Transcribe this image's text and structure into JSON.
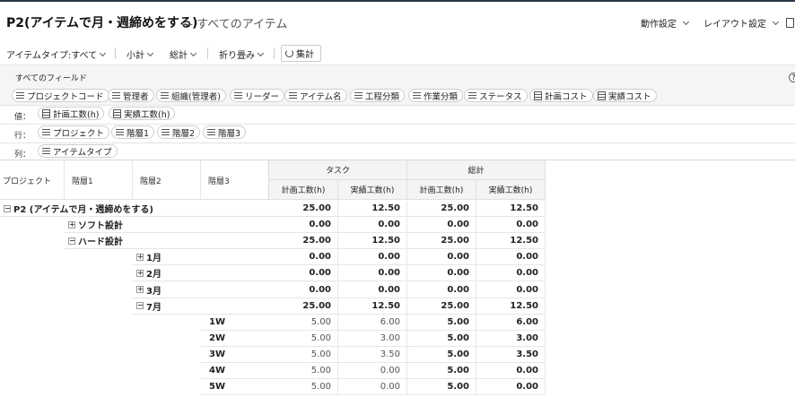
{
  "header": {
    "title": "P2(アイテムで月・週締めをする)",
    "subtitle": "— すべてのアイテム",
    "menu_action": "動作設定",
    "menu_layout": "レイアウト設定"
  },
  "toolbar": {
    "item_type": "アイテムタイプ:すべて",
    "subtotal": "小計",
    "total": "総計",
    "fold": "折り畳み",
    "aggregate": "集計"
  },
  "fields": {
    "label": "すべてのフィールド",
    "chips": [
      "プロジェクトコード",
      "管理者",
      "組織(管理者)",
      "リーダー",
      "アイテム名",
      "工程分類",
      "作業分類",
      "ステータス",
      "計画コスト",
      "実績コスト"
    ]
  },
  "zones": {
    "values_label": "値：",
    "values": [
      "計画工数(h)",
      "実績工数(h)"
    ],
    "rows_label": "行：",
    "rows": [
      "プロジェクト",
      "階層1",
      "階層2",
      "階層3"
    ],
    "cols_label": "列：",
    "cols": [
      "アイテムタイプ"
    ]
  },
  "grid": {
    "row_headers": [
      "プロジェクト",
      "階層1",
      "階層2",
      "階層3"
    ],
    "groups": [
      "タスク",
      "総計"
    ],
    "measures": [
      "計画工数(h)",
      "実績工数(h)",
      "計画工数(h)",
      "実績工数(h)"
    ],
    "rows": [
      {
        "label": "P2 (アイテムで月・週締めをする)",
        "toggle": "−",
        "values": [
          "25.00",
          "12.50",
          "25.00",
          "12.50"
        ],
        "bold": true
      },
      {
        "label": "ソフト設計",
        "toggle": "+",
        "values": [
          "0.00",
          "0.00",
          "0.00",
          "0.00"
        ],
        "bold": true
      },
      {
        "label": "ハード設計",
        "toggle": "−",
        "values": [
          "25.00",
          "12.50",
          "25.00",
          "12.50"
        ],
        "bold": true
      },
      {
        "label": "1月",
        "toggle": "+",
        "values": [
          "0.00",
          "0.00",
          "0.00",
          "0.00"
        ],
        "bold": true
      },
      {
        "label": "2月",
        "toggle": "+",
        "values": [
          "0.00",
          "0.00",
          "0.00",
          "0.00"
        ],
        "bold": true
      },
      {
        "label": "3月",
        "toggle": "+",
        "values": [
          "0.00",
          "0.00",
          "0.00",
          "0.00"
        ],
        "bold": true
      },
      {
        "label": "7月",
        "toggle": "−",
        "values": [
          "25.00",
          "12.50",
          "25.00",
          "12.50"
        ],
        "bold": true
      },
      {
        "label": "1W",
        "toggle": "",
        "values": [
          "5.00",
          "6.00",
          "5.00",
          "6.00"
        ],
        "bold": false
      },
      {
        "label": "2W",
        "toggle": "",
        "values": [
          "5.00",
          "3.00",
          "5.00",
          "3.00"
        ],
        "bold": false
      },
      {
        "label": "3W",
        "toggle": "",
        "values": [
          "5.00",
          "3.50",
          "5.00",
          "3.50"
        ],
        "bold": false
      },
      {
        "label": "4W",
        "toggle": "",
        "values": [
          "5.00",
          "0.00",
          "5.00",
          "0.00"
        ],
        "bold": false
      },
      {
        "label": "5W",
        "toggle": "",
        "values": [
          "5.00",
          "0.00",
          "5.00",
          "0.00"
        ],
        "bold": false
      }
    ]
  }
}
